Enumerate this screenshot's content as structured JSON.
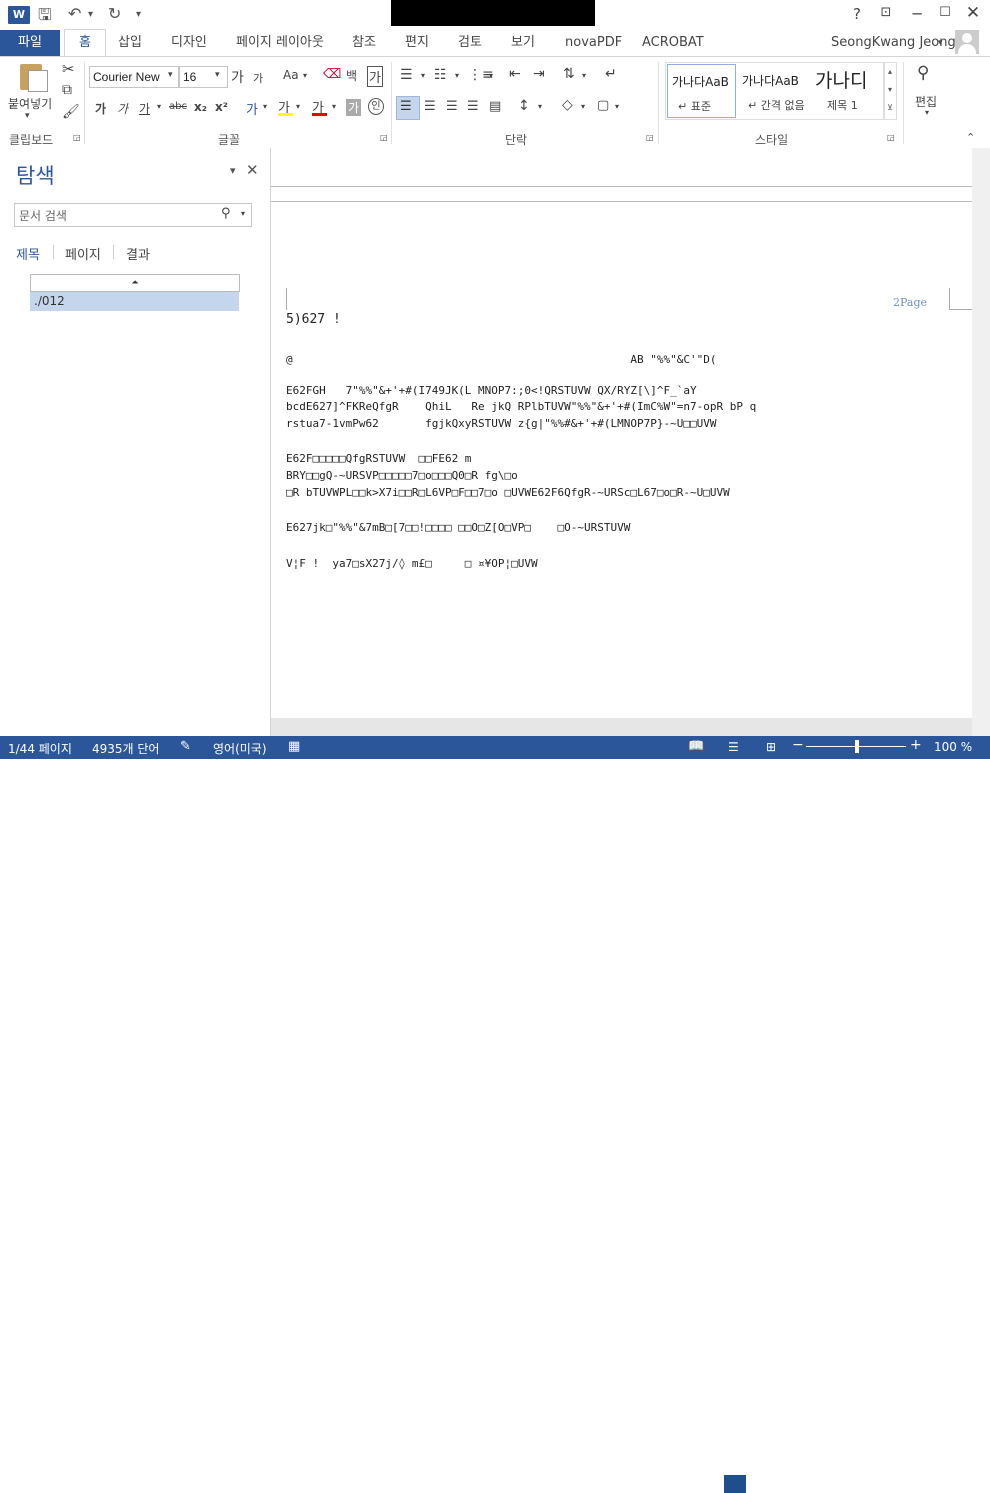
{
  "titlebar": {
    "quick_access": [
      "save-icon",
      "undo-icon",
      "redo-icon"
    ],
    "help": "?",
    "controls": [
      "ribbon-display-icon",
      "minimize-icon",
      "maximize-icon",
      "close-icon"
    ]
  },
  "tabs": {
    "file": "파일",
    "items": [
      "홈",
      "삽입",
      "디자인",
      "페이지 레이아웃",
      "참조",
      "편지",
      "검토",
      "보기",
      "novaPDF",
      "ACROBAT"
    ],
    "user": "SeongKwang Jeong"
  },
  "ribbon": {
    "clipboard": {
      "paste": "붙여넣기",
      "group": "클립보드"
    },
    "font": {
      "name": "Courier New",
      "size": "16",
      "group": "글꼴",
      "grow": "가",
      "shrink": "가",
      "case": "Aa",
      "bold": "가",
      "italic": "가",
      "underline": "가",
      "strike": "abc",
      "sub": "x₂",
      "sup": "x²"
    },
    "paragraph": {
      "group": "단락"
    },
    "styles": {
      "group": "스타일",
      "items": [
        {
          "preview": "가나다AaB",
          "name": "↵ 표준"
        },
        {
          "preview": "가나다AaB",
          "name": "↵ 간격 없음"
        },
        {
          "preview": "가나디",
          "name": "제목 1"
        }
      ]
    },
    "editing": {
      "label": "편집"
    }
  },
  "nav": {
    "title": "탐색",
    "search_placeholder": "문서 검색",
    "tabs": [
      "제목",
      "페이지",
      "결과"
    ],
    "heading_item": "./012"
  },
  "document": {
    "header_page": "2Page",
    "lines": [
      "5)627 !",
      "",
      "@                                                   AB \"%%\"&C'\"D(",
      "",
      "E62FGH   7\"%%\"&+'+#(I749JK(L MNOP7:;0<!QRSTUVW QX/RYZ[\\]^F_`aY",
      "bcdE627]^FKReQfgR    QhiL   Re jkQ RPlbTUVW\"%%\"&+'+#(ImC%W\"=n7-opR bP q",
      "rstua7-1vmPw62       fgjkQxyRSTUVW z{g|\"%%#&+'+#(LMNOP7P}-~U□□UVW",
      "",
      "E62F□□□□□QfgRSTUVW  □□FE62 m",
      "BRY□□gQ-~URSVP□□□□□7□o□□□Q0□R fg\\□o",
      "□R bTUVWPL□□k>X7i□□R□L6VP□F□□7□o □UVWE62F6QfgR-~URSc□L67□o□R-~U□UVW",
      "",
      "E627jk□\"%%\"&7mB□[7□□!□□□□ □□O□Z[O□VP□    □O-~URSTUVW",
      "",
      "V¦F !  ya7□sX27j/◊ m£□     □ ¤¥OP¦□UVW"
    ]
  },
  "status": {
    "page": "1/44 페이지",
    "words": "4935개 단어",
    "language": "영어(미국)",
    "zoom": "100 %"
  },
  "colors": {
    "accent": "#2b579a"
  }
}
